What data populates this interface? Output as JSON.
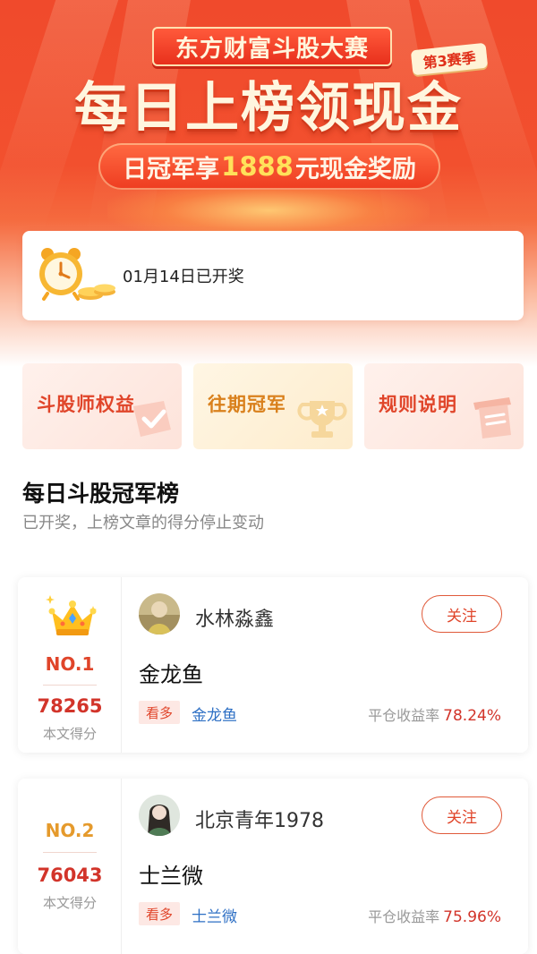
{
  "banner": {
    "event_name": "东方财富斗股大赛",
    "season": "第3赛季",
    "headline": "每日上榜领现金",
    "reward_prefix": "日冠军享",
    "reward_amount": "1888",
    "reward_suffix": "元现金奖励"
  },
  "award": {
    "icon": "alarm-clock-icon",
    "text": "01月14日已开奖"
  },
  "tiles": [
    {
      "label": "斗股师权益",
      "icon": "checkmark-icon"
    },
    {
      "label": "往期冠军",
      "icon": "trophy-icon"
    },
    {
      "label": "规则说明",
      "icon": "document-icon"
    }
  ],
  "leaderboard": {
    "title": "每日斗股冠军榜",
    "subtitle": "已开奖，上榜文章的得分停止变动",
    "entries": [
      {
        "rank": "NO.1",
        "score": "78265",
        "score_label": "本文得分",
        "user": "水林淼鑫",
        "follow": "关注",
        "post_title": "金龙鱼",
        "tag": "看多",
        "stock": "金龙鱼",
        "yield_label": "平仓收益率",
        "yield_value": "78.24%"
      },
      {
        "rank": "NO.2",
        "score": "76043",
        "score_label": "本文得分",
        "user": "北京青年1978",
        "follow": "关注",
        "post_title": "士兰微",
        "tag": "看多",
        "stock": "士兰微",
        "yield_label": "平仓收益率",
        "yield_value": "75.96%"
      }
    ]
  },
  "colors": {
    "brand_red": "#e0452a",
    "score_red": "#d2342a",
    "gold": "#e59a2c",
    "link_blue": "#2d6fc4"
  }
}
